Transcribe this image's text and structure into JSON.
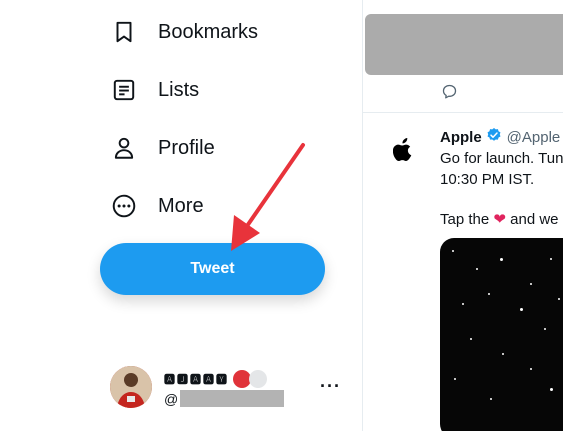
{
  "sidebar": {
    "items": [
      {
        "label": "Bookmarks",
        "icon": "bookmark-icon"
      },
      {
        "label": "Lists",
        "icon": "lists-icon"
      },
      {
        "label": "Profile",
        "icon": "profile-icon"
      },
      {
        "label": "More",
        "icon": "more-circle-icon"
      }
    ],
    "tweet_button": "Tweet",
    "account": {
      "display_name": "🅰🅹🅰🅰🆈",
      "handle_prefix": "@"
    }
  },
  "feed": {
    "tweet": {
      "author": "Apple",
      "handle": "@Apple",
      "line1": "Go for launch. Tun",
      "line2": "10:30 PM IST.",
      "line3_a": "Tap the",
      "line3_b": "and we"
    }
  },
  "colors": {
    "accent": "#1d9bf0",
    "arrow": "#e8333b",
    "heart": "#e0245e"
  }
}
